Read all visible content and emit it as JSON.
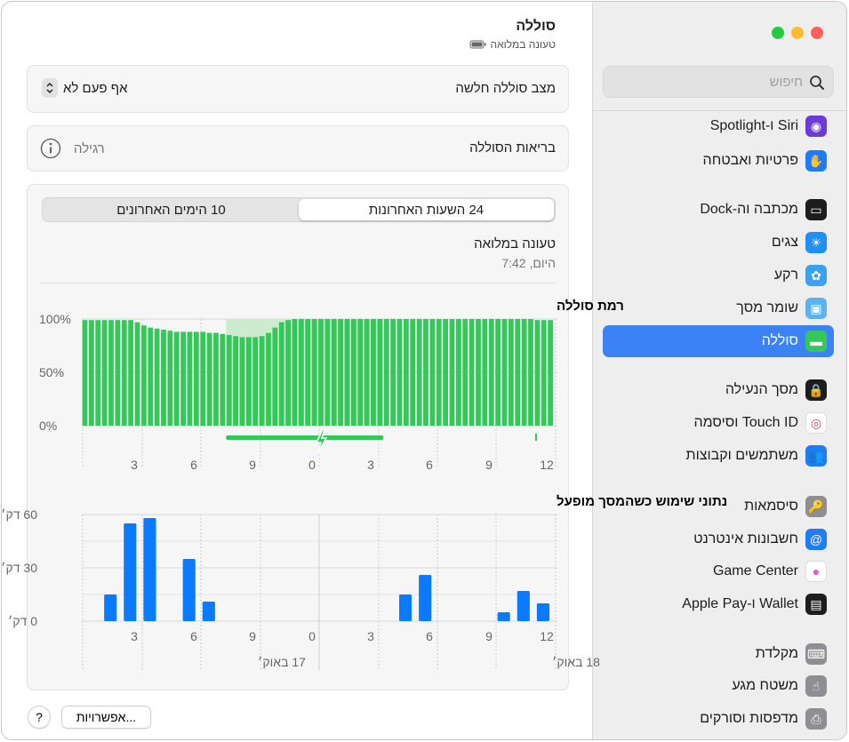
{
  "colors": {
    "accent": "#3b82f6",
    "battery_green": "#34c759",
    "charge_band": "#cdeccf",
    "bar_blue": "#0a7aff",
    "traffic_green": "#28c840",
    "traffic_yellow": "#febc2e",
    "traffic_red": "#ff5f57"
  },
  "sidebar": {
    "search_placeholder": "חיפוש",
    "items": [
      {
        "label": "Siri ו-Spotlight",
        "icon": "siri-icon",
        "color": "#6a3bd6"
      },
      {
        "label": "פרטיות ואבטחה",
        "icon": "hand-icon",
        "color": "#1f7cf5"
      },
      {
        "label": "מכתבה וה-Dock",
        "icon": "dock-icon",
        "color": "#1d1d1f"
      },
      {
        "label": "צגים",
        "icon": "display-brightness-icon",
        "color": "#1f8ef5"
      },
      {
        "label": "רקע",
        "icon": "wallpaper-flower-icon",
        "color": "#3aa0f0"
      },
      {
        "label": "שומר מסך",
        "icon": "screensaver-icon",
        "color": "#5ab2f0"
      },
      {
        "label": "סוללה",
        "icon": "battery-icon",
        "color": "#34c759"
      },
      {
        "label": "מסך הנעילה",
        "icon": "lock-icon",
        "color": "#1d1d1f"
      },
      {
        "label": "Touch ID וסיסמה",
        "icon": "fingerprint-icon",
        "color": "#ffffff"
      },
      {
        "label": "משתמשים וקבוצות",
        "icon": "users-icon",
        "color": "#1f7cf5"
      },
      {
        "label": "סיסמאות",
        "icon": "key-icon",
        "color": "#8e8e93"
      },
      {
        "label": "חשבונות אינטרנט",
        "icon": "at-icon",
        "color": "#1f7cf5"
      },
      {
        "label": "Game Center",
        "icon": "game-center-icon",
        "color": "#ffffff"
      },
      {
        "label": "Wallet ו-Apple Pay",
        "icon": "wallet-icon",
        "color": "#1d1d1f"
      },
      {
        "label": "מקלדת",
        "icon": "keyboard-icon",
        "color": "#8e8e93"
      },
      {
        "label": "משטח מגע",
        "icon": "trackpad-icon",
        "color": "#8e8e93"
      },
      {
        "label": "מדפסות וסורקים",
        "icon": "printer-icon",
        "color": "#8e8e93"
      }
    ],
    "selected_index": 6
  },
  "main": {
    "title": "סוללה",
    "subtitle": "טעונה במלואה",
    "low_power": {
      "label": "מצב סוללה חלשה",
      "value": "אף פעם לא"
    },
    "health": {
      "label": "בריאות הסוללה",
      "value": "רגילה"
    },
    "tabs": [
      {
        "label": "24 השעות האחרונות",
        "active": true
      },
      {
        "label": "10 הימים האחרונים",
        "active": false
      }
    ],
    "status": {
      "title": "טעונה במלואה",
      "time": "היום, 7:42"
    },
    "options_button": "אפשרויות...",
    "help_button": "?"
  },
  "chart_data": [
    {
      "type": "bar",
      "title": "רמת סוללה",
      "ylabel": "",
      "ylim": [
        0,
        100
      ],
      "yticks": [
        "0%",
        "50%",
        "100%"
      ],
      "xticks": [
        "3",
        "6",
        "9",
        "0",
        "3",
        "6",
        "9",
        "12"
      ],
      "charging_period": {
        "start_index": 22,
        "end_index": 46
      },
      "values": [
        99,
        99,
        99,
        99,
        99,
        99,
        99,
        99,
        97,
        94,
        92,
        91,
        90,
        89,
        88,
        88,
        88,
        88,
        88,
        87,
        87,
        86,
        85,
        84,
        83,
        83,
        83,
        84,
        87,
        92,
        97,
        99,
        100,
        100,
        100,
        100,
        100,
        100,
        100,
        100,
        100,
        100,
        100,
        100,
        100,
        100,
        100,
        100,
        100,
        100,
        100,
        100,
        100,
        100,
        100,
        100,
        100,
        100,
        100,
        100,
        100,
        100,
        100,
        100,
        100,
        100,
        100,
        100,
        100,
        99,
        99,
        99
      ]
    },
    {
      "type": "bar",
      "title": "נתוני שימוש כשהמסך מופעל",
      "ylim": [
        0,
        60
      ],
      "yticks": [
        "0 דק׳",
        "30 דק׳",
        "60 דק׳"
      ],
      "xticks": [
        "3",
        "6",
        "9",
        "0",
        "3",
        "6",
        "9",
        "12"
      ],
      "date_labels": [
        "17 באוק׳",
        "18 באוק׳"
      ],
      "values": [
        0,
        15,
        55,
        58,
        0,
        35,
        11,
        0,
        0,
        0,
        0,
        0,
        0,
        0,
        0,
        0,
        15,
        26,
        0,
        0,
        0,
        5,
        17,
        10
      ]
    }
  ]
}
